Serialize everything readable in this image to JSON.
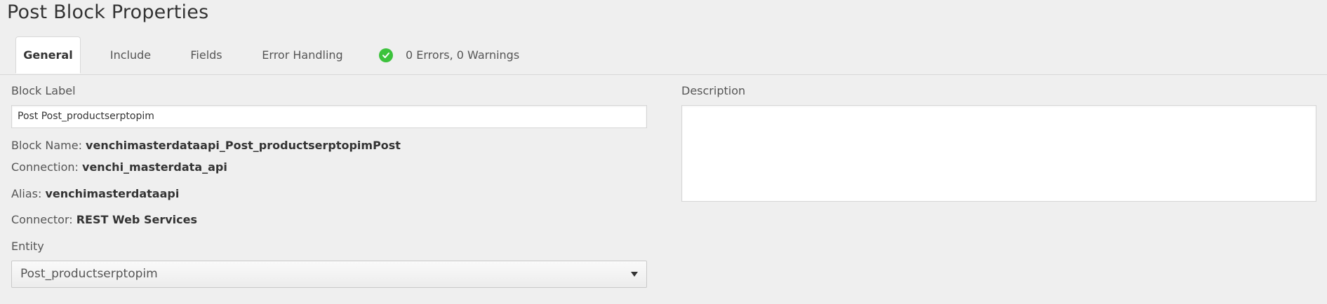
{
  "page_title": "Post Block Properties",
  "tabs": [
    {
      "label": "General",
      "active": true
    },
    {
      "label": "Include",
      "active": false
    },
    {
      "label": "Fields",
      "active": false
    },
    {
      "label": "Error Handling",
      "active": false
    }
  ],
  "status": {
    "text": "0 Errors, 0 Warnings",
    "icon": "check-circle-icon",
    "color": "#3cc23c"
  },
  "form": {
    "block_label": {
      "label": "Block Label",
      "value": "Post Post_productserptopim"
    },
    "block_name": {
      "key": "Block Name:",
      "value": "venchimasterdataapi_Post_productserptopimPost"
    },
    "connection": {
      "key": "Connection:",
      "value": "venchi_masterdata_api"
    },
    "alias": {
      "key": "Alias:",
      "value": "venchimasterdataapi"
    },
    "connector": {
      "key": "Connector:",
      "value": "REST Web Services"
    },
    "entity": {
      "label": "Entity",
      "selected": "Post_productserptopim"
    },
    "description": {
      "label": "Description",
      "value": ""
    }
  }
}
